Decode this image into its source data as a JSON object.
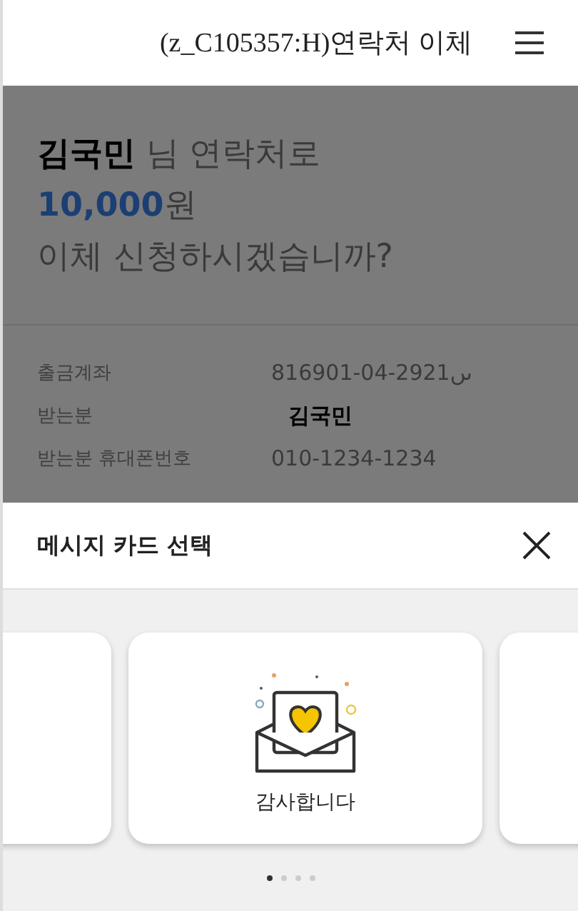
{
  "header": {
    "title": "(z_C105357:H)연락처 이체"
  },
  "headline": {
    "name": "김국민",
    "name_suffix": "님 연락처로",
    "amount": "10,000",
    "unit": "원",
    "question": "이체 신청하시겠습니까?"
  },
  "details": [
    {
      "label": "출금계좌",
      "value": "816901-04-2921ںں",
      "emphasized": false
    },
    {
      "label": "받는분",
      "value": "김국민",
      "emphasized": true
    },
    {
      "label": "받는분 휴대폰번호",
      "value": "010-1234-1234",
      "emphasized": false
    }
  ],
  "sheet": {
    "title": "메시지 카드 선택"
  },
  "cards": [
    {
      "kind": "partial"
    },
    {
      "label": "감사합니다",
      "kind": "thanks"
    },
    {
      "kind": "partial"
    }
  ],
  "pager": [
    {
      "selected": true
    },
    {
      "selected": false
    },
    {
      "selected": false
    },
    {
      "selected": false
    }
  ]
}
